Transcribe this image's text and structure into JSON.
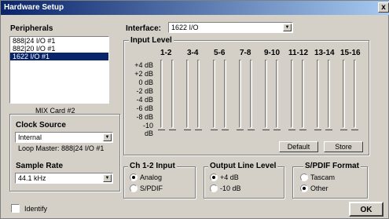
{
  "window": {
    "title": "Hardware Setup",
    "close_glyph": "x"
  },
  "peripherals": {
    "label": "Peripherals",
    "items": [
      "888|24 I/O #1",
      "882|20 I/O #1",
      "1622 I/O #1"
    ],
    "selected_index": 2,
    "card_label": "MIX Card #2"
  },
  "clock": {
    "label": "Clock Source",
    "value": "Internal",
    "loop_master": "Loop Master: 888|24 I/O #1"
  },
  "sample_rate": {
    "label": "Sample Rate",
    "value": "44.1 kHz"
  },
  "interface": {
    "label": "Interface:",
    "value": "1622 I/O"
  },
  "input_level": {
    "label": "Input Level",
    "channels": [
      "1-2",
      "3-4",
      "5-6",
      "7-8",
      "9-10",
      "11-12",
      "13-14",
      "15-16"
    ],
    "db_scale": [
      "+4 dB",
      "+2 dB",
      "0 dB",
      "-2 dB",
      "-4 dB",
      "-6 dB",
      "-8 dB",
      "-10 dB"
    ],
    "default_label": "Default",
    "store_label": "Store"
  },
  "ch12_input": {
    "label": "Ch 1-2 Input",
    "options": [
      "Analog",
      "S/PDIF"
    ],
    "selected": "Analog"
  },
  "output_line_level": {
    "label": "Output Line Level",
    "options": [
      "+4 dB",
      "-10 dB"
    ],
    "selected": "+4 dB"
  },
  "spdif_format": {
    "label": "S/PDIF Format",
    "options": [
      "Tascam",
      "Other"
    ],
    "selected": "Other"
  },
  "identify": {
    "label": "Identify",
    "checked": false
  },
  "ok_label": "OK",
  "icons": {
    "dropdown": "chevron-down-icon",
    "close": "close-icon"
  }
}
